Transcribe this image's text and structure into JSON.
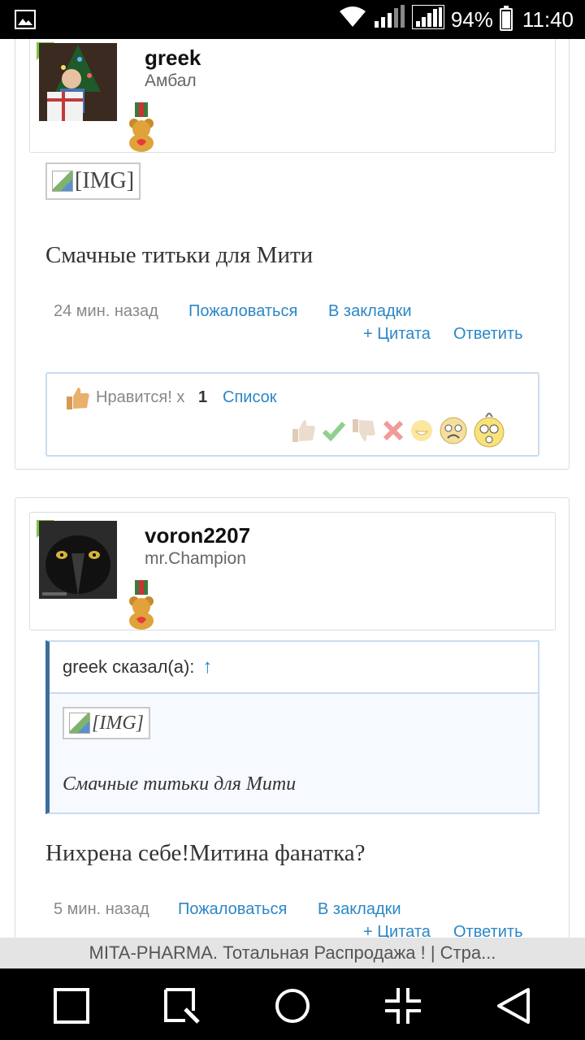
{
  "status_bar": {
    "battery_percent": "94%",
    "time": "11:40",
    "icons": [
      "image-icon",
      "wifi-icon",
      "signal-icon",
      "signal-icon",
      "battery-icon"
    ]
  },
  "posts": [
    {
      "username": "greek",
      "user_title": "Амбал",
      "image_placeholder": "[IMG]",
      "message": "Смачные титьки для Мити",
      "time_ago": "24 мин. назад",
      "report": "Пожаловаться",
      "bookmark": "В закладки",
      "quote": "+ Цитата",
      "reply": "Ответить",
      "likes": {
        "label": "Нравится! x",
        "count": "1",
        "list": "Список"
      }
    },
    {
      "username": "voron2207",
      "user_title": "mr.Champion",
      "quote_header": "greek сказал(а):",
      "quote_arrow": "↑",
      "quote_image_placeholder": "[IMG]",
      "quote_text": "Смачные титьки для Мити",
      "message": "Нихрена себе!Митина фанатка?",
      "time_ago": "5 мин. назад",
      "report": "Пожаловаться",
      "bookmark": "В закладки",
      "quote": "+ Цитата",
      "reply": "Ответить"
    }
  ],
  "reaction_icons": [
    "like-icon",
    "agree-icon",
    "dislike-icon",
    "disagree-icon",
    "funny-icon",
    "sad-icon",
    "shocked-icon"
  ],
  "page_title": "MITA-PHARMA. Тотальная Распродажа ! | Стра...",
  "nav": [
    "square-icon",
    "search-square-icon",
    "circle-icon",
    "minimize-icon",
    "back-triangle-icon"
  ],
  "colors": {
    "link": "#2b87c6",
    "accent_green": "#7cc24a",
    "quote_border": "#3b6e9d"
  }
}
